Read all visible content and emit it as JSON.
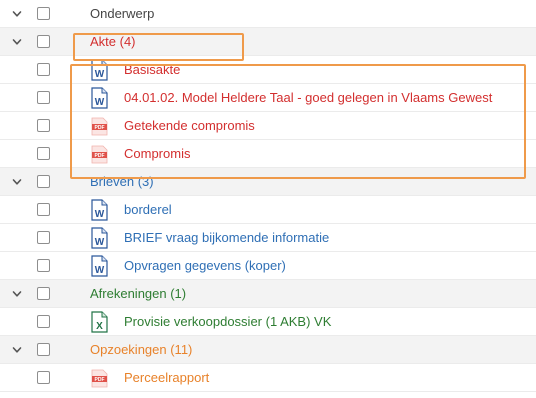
{
  "header": {
    "label": "Onderwerp"
  },
  "groups": [
    {
      "label": "Akte (4)",
      "color": "#d32f2f",
      "items": [
        {
          "label": "Basisakte",
          "icon": "word-icon"
        },
        {
          "label": "04.01.02. Model Heldere Taal - goed gelegen in Vlaams Gewest",
          "icon": "word-icon"
        },
        {
          "label": "Getekende compromis",
          "icon": "pdf-icon"
        },
        {
          "label": "Compromis",
          "icon": "pdf-icon"
        }
      ]
    },
    {
      "label": "Brieven (3)",
      "color": "#2f6fb5",
      "items": [
        {
          "label": "borderel",
          "icon": "word-icon"
        },
        {
          "label": "BRIEF vraag bijkomende informatie",
          "icon": "word-icon"
        },
        {
          "label": "Opvragen gegevens (koper)",
          "icon": "word-icon"
        }
      ]
    },
    {
      "label": "Afrekeningen (1)",
      "color": "#2e7d32",
      "items": [
        {
          "label": "Provisie verkoopdossier (1 AKB) VK",
          "icon": "excel-icon"
        }
      ]
    },
    {
      "label": "Opzoekingen (11)",
      "color": "#e8822a",
      "items": [
        {
          "label": "Perceelrapport",
          "icon": "pdf-icon"
        }
      ]
    }
  ],
  "colors": {
    "highlight": "#ef9a4a",
    "word": "#2b579a",
    "excel": "#217346",
    "pdf": "#e0524a"
  }
}
